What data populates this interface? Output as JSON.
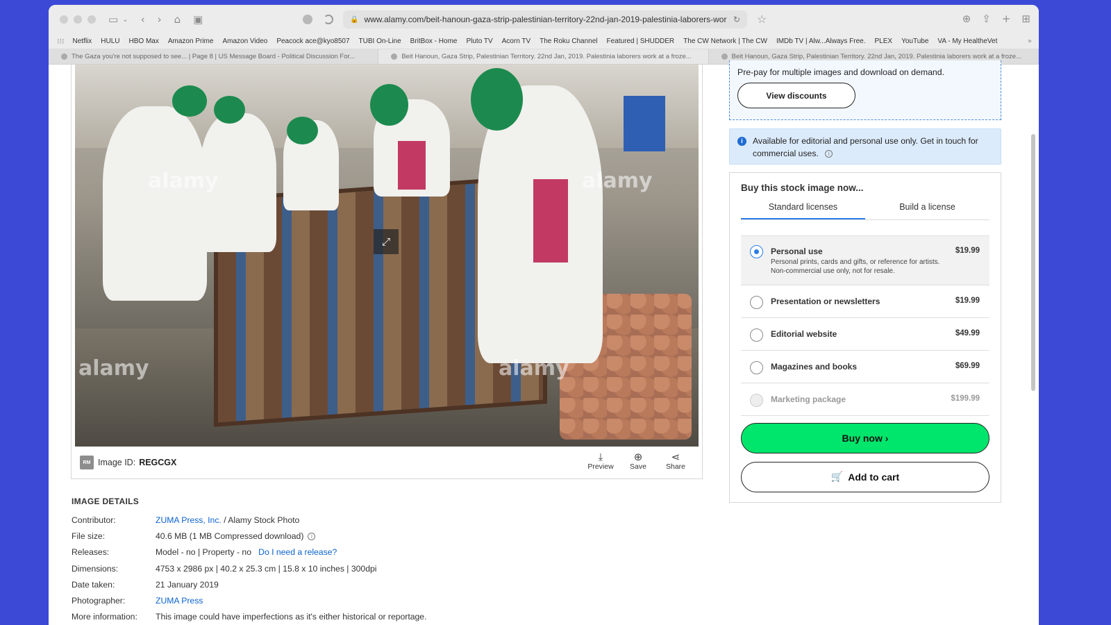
{
  "browser": {
    "url": "www.alamy.com/beit-hanoun-gaza-strip-palestinian-territory-22nd-jan-2019-palestinia-laborers-wor",
    "bookmarks": [
      "Netflix",
      "HULU",
      "HBO Max",
      "Amazon Prime",
      "Amazon Video",
      "Peacock ace@kyo8507",
      "TUBI On-Line",
      "BritBox - Home",
      "Pluto TV",
      "Acorn TV",
      "The Roku Channel",
      "Featured | SHUDDER",
      "The CW Network | The CW",
      "IMDb TV | Alw...Always Free.",
      "PLEX",
      "YouTube",
      "VA - My HealtheVet"
    ],
    "tabs": [
      {
        "label": "The Gaza you're not supposed to see... | Page 8 | US Message Board - Political Discussion For..."
      },
      {
        "label": "Beit Hanoun, Gaza Strip, Palestinian Territory. 22nd Jan, 2019. Palestinia laborers work at a froze..."
      },
      {
        "label": "Beit Hanoun, Gaza Strip, Palestinian Territory. 22nd Jan, 2019. Palestinia laborers work at a froze..."
      }
    ]
  },
  "image": {
    "watermark": "alamy",
    "rm_badge": "RM",
    "id_label": "Image ID:",
    "id_value": "REGCGX",
    "actions": {
      "preview": "Preview",
      "save": "Save",
      "share": "Share"
    }
  },
  "details": {
    "heading": "IMAGE DETAILS",
    "contributor_label": "Contributor:",
    "contributor_link": "ZUMA Press, Inc.",
    "contributor_rest": " / Alamy Stock Photo",
    "filesize_label": "File size:",
    "filesize_value": "40.6 MB (1 MB Compressed download)",
    "releases_label": "Releases:",
    "releases_value": "Model - no | Property - no",
    "releases_link": "Do I need a release?",
    "dimensions_label": "Dimensions:",
    "dimensions_value": "4753 x 2986 px | 40.2 x 25.3 cm | 15.8 x 10 inches | 300dpi",
    "date_label": "Date taken:",
    "date_value": "21 January 2019",
    "photographer_label": "Photographer:",
    "photographer_value": "ZUMA Press",
    "more_label": "More information:",
    "more_value": "This image could have imperfections as it's either historical or reportage."
  },
  "sidebar": {
    "discount_text": "Pre-pay for multiple images and download on demand.",
    "view_discounts": "View discounts",
    "notice": "Available for editorial and personal use only. Get in touch for commercial uses.",
    "buy_title": "Buy this stock image now...",
    "tab_standard": "Standard licenses",
    "tab_build": "Build a license",
    "options": [
      {
        "name": "Personal use",
        "price": "$19.99",
        "desc": "Personal prints, cards and gifts, or reference for artists. Non-commercial use only, not for resale."
      },
      {
        "name": "Presentation or newsletters",
        "price": "$19.99"
      },
      {
        "name": "Editorial website",
        "price": "$49.99"
      },
      {
        "name": "Magazines and books",
        "price": "$69.99"
      },
      {
        "name": "Marketing package",
        "price": "$199.99"
      }
    ],
    "buy_now": "Buy now ›",
    "add_to_cart": "Add to cart"
  },
  "colors": {
    "accent": "#00e56b",
    "link": "#0b63ce",
    "background": "#3b49d6"
  }
}
